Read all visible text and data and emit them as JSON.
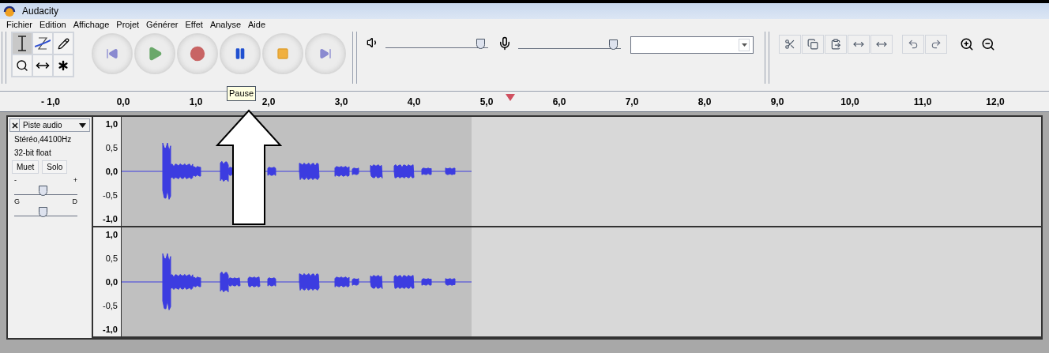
{
  "window": {
    "title": "Audacity"
  },
  "menu": [
    "Fichier",
    "Edition",
    "Affichage",
    "Projet",
    "Générer",
    "Effet",
    "Analyse",
    "Aide"
  ],
  "tools": [
    {
      "kind": "select",
      "selected": true
    },
    {
      "kind": "envelope",
      "selected": false
    },
    {
      "kind": "draw",
      "selected": false
    },
    {
      "kind": "zoom",
      "selected": false
    },
    {
      "kind": "timeshift",
      "selected": false
    },
    {
      "kind": "multi",
      "selected": false
    }
  ],
  "transport": [
    {
      "kind": "skip-start"
    },
    {
      "kind": "play"
    },
    {
      "kind": "record"
    },
    {
      "kind": "pause"
    },
    {
      "kind": "stop"
    },
    {
      "kind": "skip-end"
    }
  ],
  "tooltip": "Pause",
  "meters": [
    {
      "kind": "playback",
      "level": 0.97
    },
    {
      "kind": "recording",
      "level": 0.97
    }
  ],
  "ruler": [
    "- 1,0",
    "0,0",
    "1,0",
    "2,0",
    "3,0",
    "4,0",
    "5,0",
    "6,0",
    "7,0",
    "8,0",
    "9,0",
    "10,0",
    "11,0",
    "12,0"
  ],
  "track": {
    "name": "Piste audio",
    "info": [
      "Stéréo,44100Hz",
      "32-bit float"
    ],
    "buttons": [
      "Muet",
      "Solo"
    ],
    "gain": {
      "min": "-",
      "max": "+",
      "level": 0.45
    },
    "pan": {
      "min": "G",
      "max": "D",
      "level": 0.45
    },
    "channels": [
      {
        "scale": [
          "1,0",
          "0,5",
          "0,0",
          "-0,5",
          "-1,0"
        ]
      },
      {
        "scale": [
          "1,0",
          "0,5",
          "0,0",
          "-0,5",
          "-1,0"
        ]
      }
    ]
  }
}
